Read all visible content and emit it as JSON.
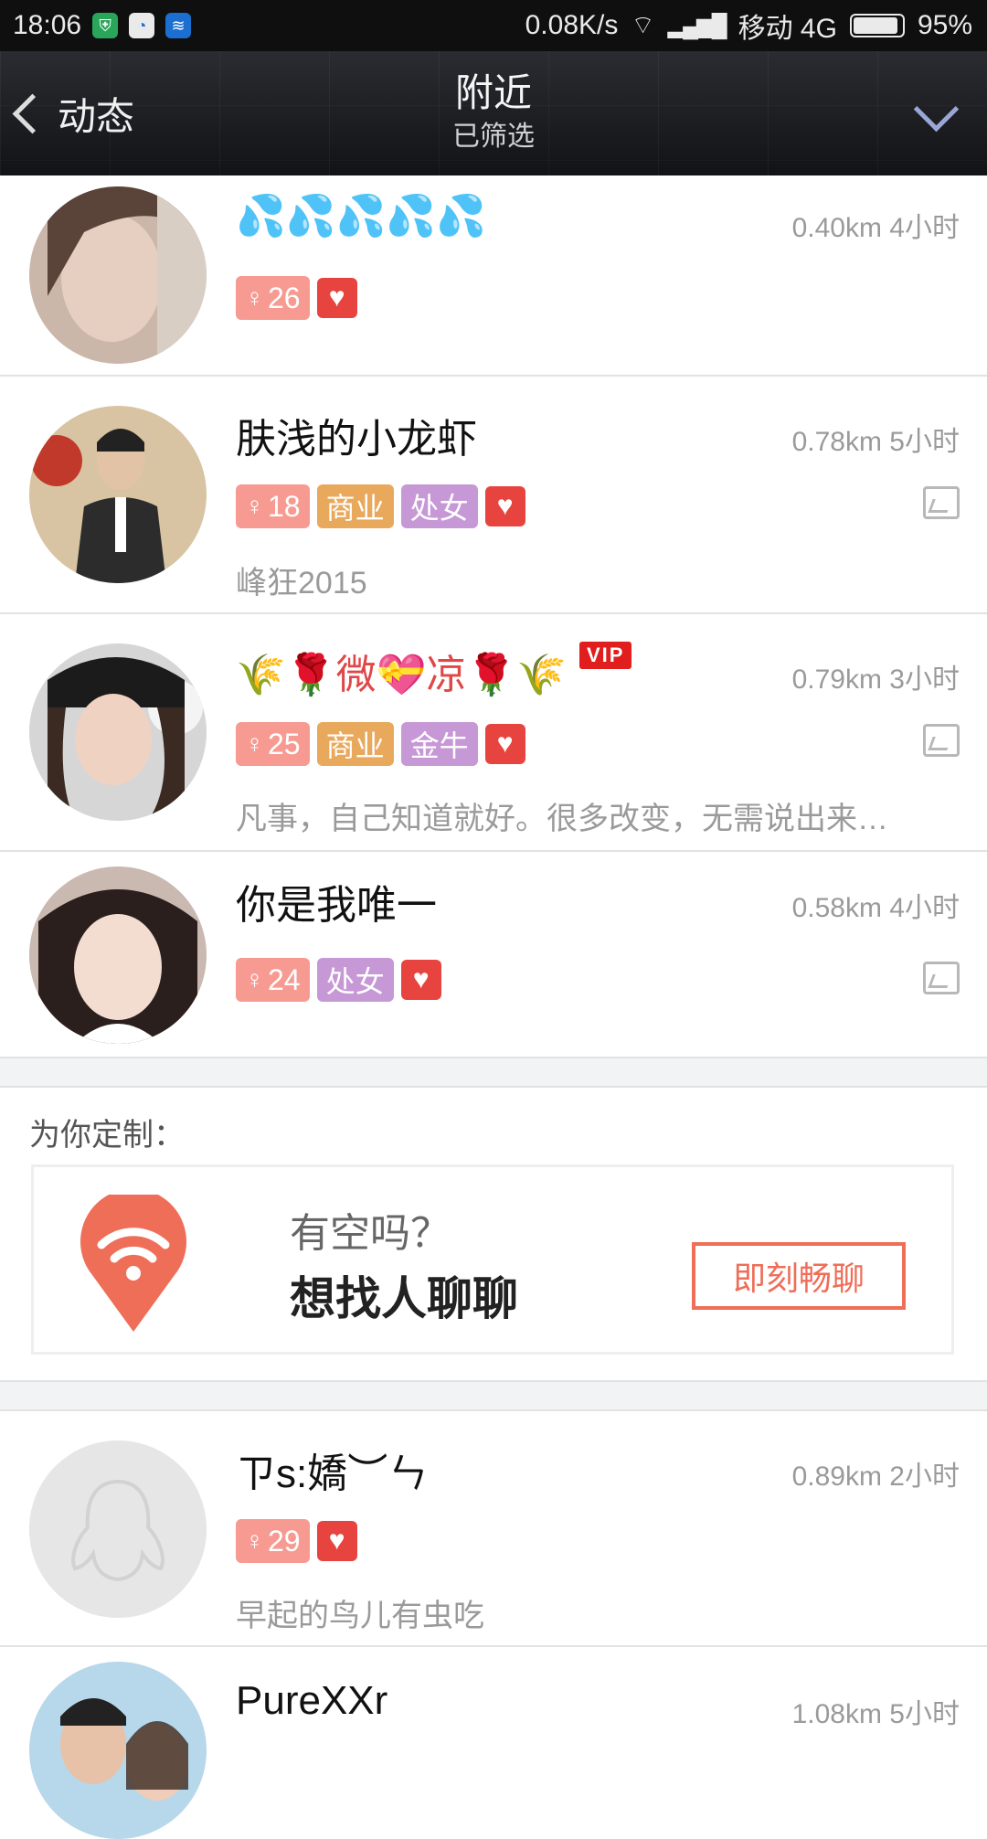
{
  "status_bar": {
    "time": "18:06",
    "net_speed": "0.08K/s",
    "carrier": "移动 4G",
    "battery": "95%",
    "battery_level": 0.95
  },
  "header": {
    "back_label": "动态",
    "title": "附近",
    "subtitle": "已筛选"
  },
  "users": [
    {
      "name": "💦💦💦💦💦",
      "distance_time": "0.40km 4小时",
      "age": "26",
      "tags": [],
      "signature": "",
      "has_photos": false,
      "vip": false
    },
    {
      "name": "肤浅的小龙虾",
      "distance_time": "0.78km 5小时",
      "age": "18",
      "tags": [
        "商业",
        "处女"
      ],
      "signature": "峰狂2015",
      "has_photos": true,
      "vip": false
    },
    {
      "name": "🌾🌹微💝凉🌹🌾",
      "distance_time": "0.79km 3小时",
      "age": "25",
      "tags": [
        "商业",
        "金牛"
      ],
      "signature": "凡事，自己知道就好。很多改变，无需说出来…",
      "has_photos": true,
      "vip": true,
      "vip_label": "VIP"
    },
    {
      "name": "你是我唯一",
      "distance_time": "0.58km 4小时",
      "age": "24",
      "tags": [
        "处女"
      ],
      "signature": "",
      "has_photos": true,
      "vip": false
    }
  ],
  "custom_section": {
    "title": "为你定制：",
    "promo_question": "有空吗？",
    "promo_main": "想找人聊聊",
    "promo_button": "即刻畅聊"
  },
  "users_more": [
    {
      "name": "ㄗs:嬌︶ㄣ",
      "distance_time": "0.89km 2小时",
      "age": "29",
      "signature": "早起的鸟儿有虫吃"
    },
    {
      "name": "PureXXr",
      "distance_time": "1.08km 5小时"
    }
  ],
  "colors": {
    "age_tag": "#f79b92",
    "business_tag": "#e8a95c",
    "purple_tag": "#c798d6",
    "accent": "#ef6e58",
    "vip": "#e01e1e"
  }
}
